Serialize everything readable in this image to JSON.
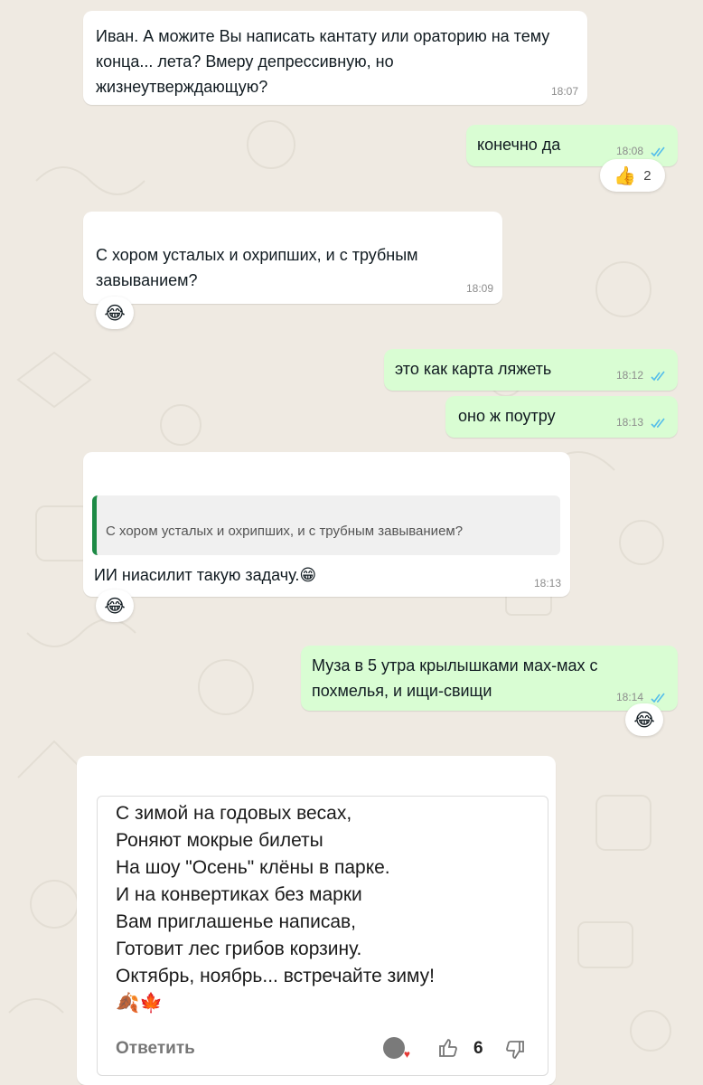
{
  "messages": [
    {
      "text": "Иван. А можите Вы написать кантату или ораторию на тему конца... лета? Вмеру депрессивную, но жизнеутверждающую?",
      "time": "18:07"
    },
    {
      "text": "конечно да",
      "time": "18:08",
      "reaction": {
        "emoji": "👍",
        "count": "2"
      }
    },
    {
      "text": "С хором усталых и охрипших, и с трубным завыванием?",
      "time": "18:09",
      "reaction": {
        "emoji": "😂"
      }
    },
    {
      "text": "это как карта ляжеть",
      "time": "18:12"
    },
    {
      "text": "оно ж поутру",
      "time": "18:13"
    },
    {
      "quote": "С хором усталых и охрипших, и с трубным завыванием?",
      "text": "ИИ ниасилит такую задачу.😁",
      "time": "18:13",
      "reaction": {
        "emoji": "😂"
      }
    },
    {
      "text": "Муза в 5 утра крылышками мах-мах с похмелья, и ищи-свищи",
      "time": "18:14",
      "reaction": {
        "emoji": "😂"
      }
    }
  ],
  "comment": {
    "lines": [
      "С зимой на годовых весах,",
      "Роняют мокрые билеты",
      "На шоу \"Осень\" клёны в парке.",
      "И на конвертиках без марки",
      "Вам приглашенье написав,",
      "Готовит лес грибов корзину.",
      "Октябрь, ноябрь... встречайте зиму!",
      "🍂🍁"
    ],
    "reply_label": "Ответить",
    "likes": "6"
  },
  "colors": {
    "outgoing": "#d9fdd3",
    "incoming": "#ffffff",
    "read_check": "#53bdeb",
    "quote_bar": "#1d8a45"
  }
}
